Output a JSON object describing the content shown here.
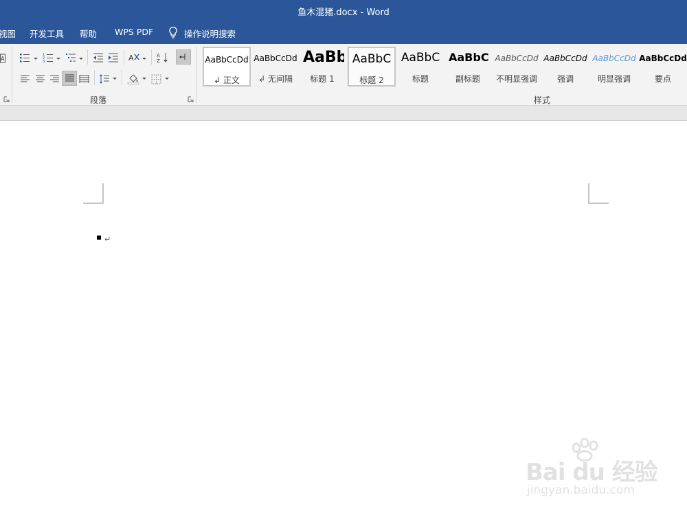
{
  "window": {
    "title": "鱼木混猪.docx  -  Word"
  },
  "ribbon_tabs": [
    "视图",
    "开发工具",
    "帮助",
    "WPS PDF"
  ],
  "tell_me": {
    "label": "操作说明搜索",
    "icon": "lightbulb-icon"
  },
  "groups": {
    "paragraph": "段落",
    "styles": "样式"
  },
  "paragraph_tools": {
    "row1": [
      "bullets-icon",
      "numbering-icon",
      "multilevel-list-icon",
      "decrease-indent-icon",
      "increase-indent-icon",
      "chinese-layout-icon",
      "sort-icon",
      "show-marks-icon"
    ],
    "row2": [
      "align-left-icon",
      "center-icon",
      "align-right-icon",
      "justify-icon",
      "distributed-icon",
      "line-spacing-icon",
      "shading-icon",
      "borders-icon"
    ],
    "active": [
      "show-marks-icon",
      "justify-icon"
    ]
  },
  "styles": [
    {
      "sample": "AaBbCcDd",
      "name": "↲ 正文"
    },
    {
      "sample": "AaBbCcDd",
      "name": "↲ 无间隔"
    },
    {
      "sample": "AaBb",
      "name": "标题 1"
    },
    {
      "sample": "AaBbC",
      "name": "标题 2"
    },
    {
      "sample": "AaBbC",
      "name": "标题"
    },
    {
      "sample": "AaBbC",
      "name": "副标题"
    },
    {
      "sample": "AaBbCcDd",
      "name": "不明显强调"
    },
    {
      "sample": "AaBbCcDd",
      "name": "强调"
    },
    {
      "sample": "AaBbCcDd",
      "name": "明显强调"
    },
    {
      "sample": "AaBbCcDd",
      "name": "要点"
    }
  ],
  "document": {
    "paragraph_mark": "↵"
  },
  "watermark": {
    "brand": "Bai du 经验",
    "url": "jingyan.baidu.com"
  },
  "colors": {
    "titlebar": "#2b579a",
    "ribbon": "#f3f3f3",
    "accent_link": "#5b9bd5"
  }
}
